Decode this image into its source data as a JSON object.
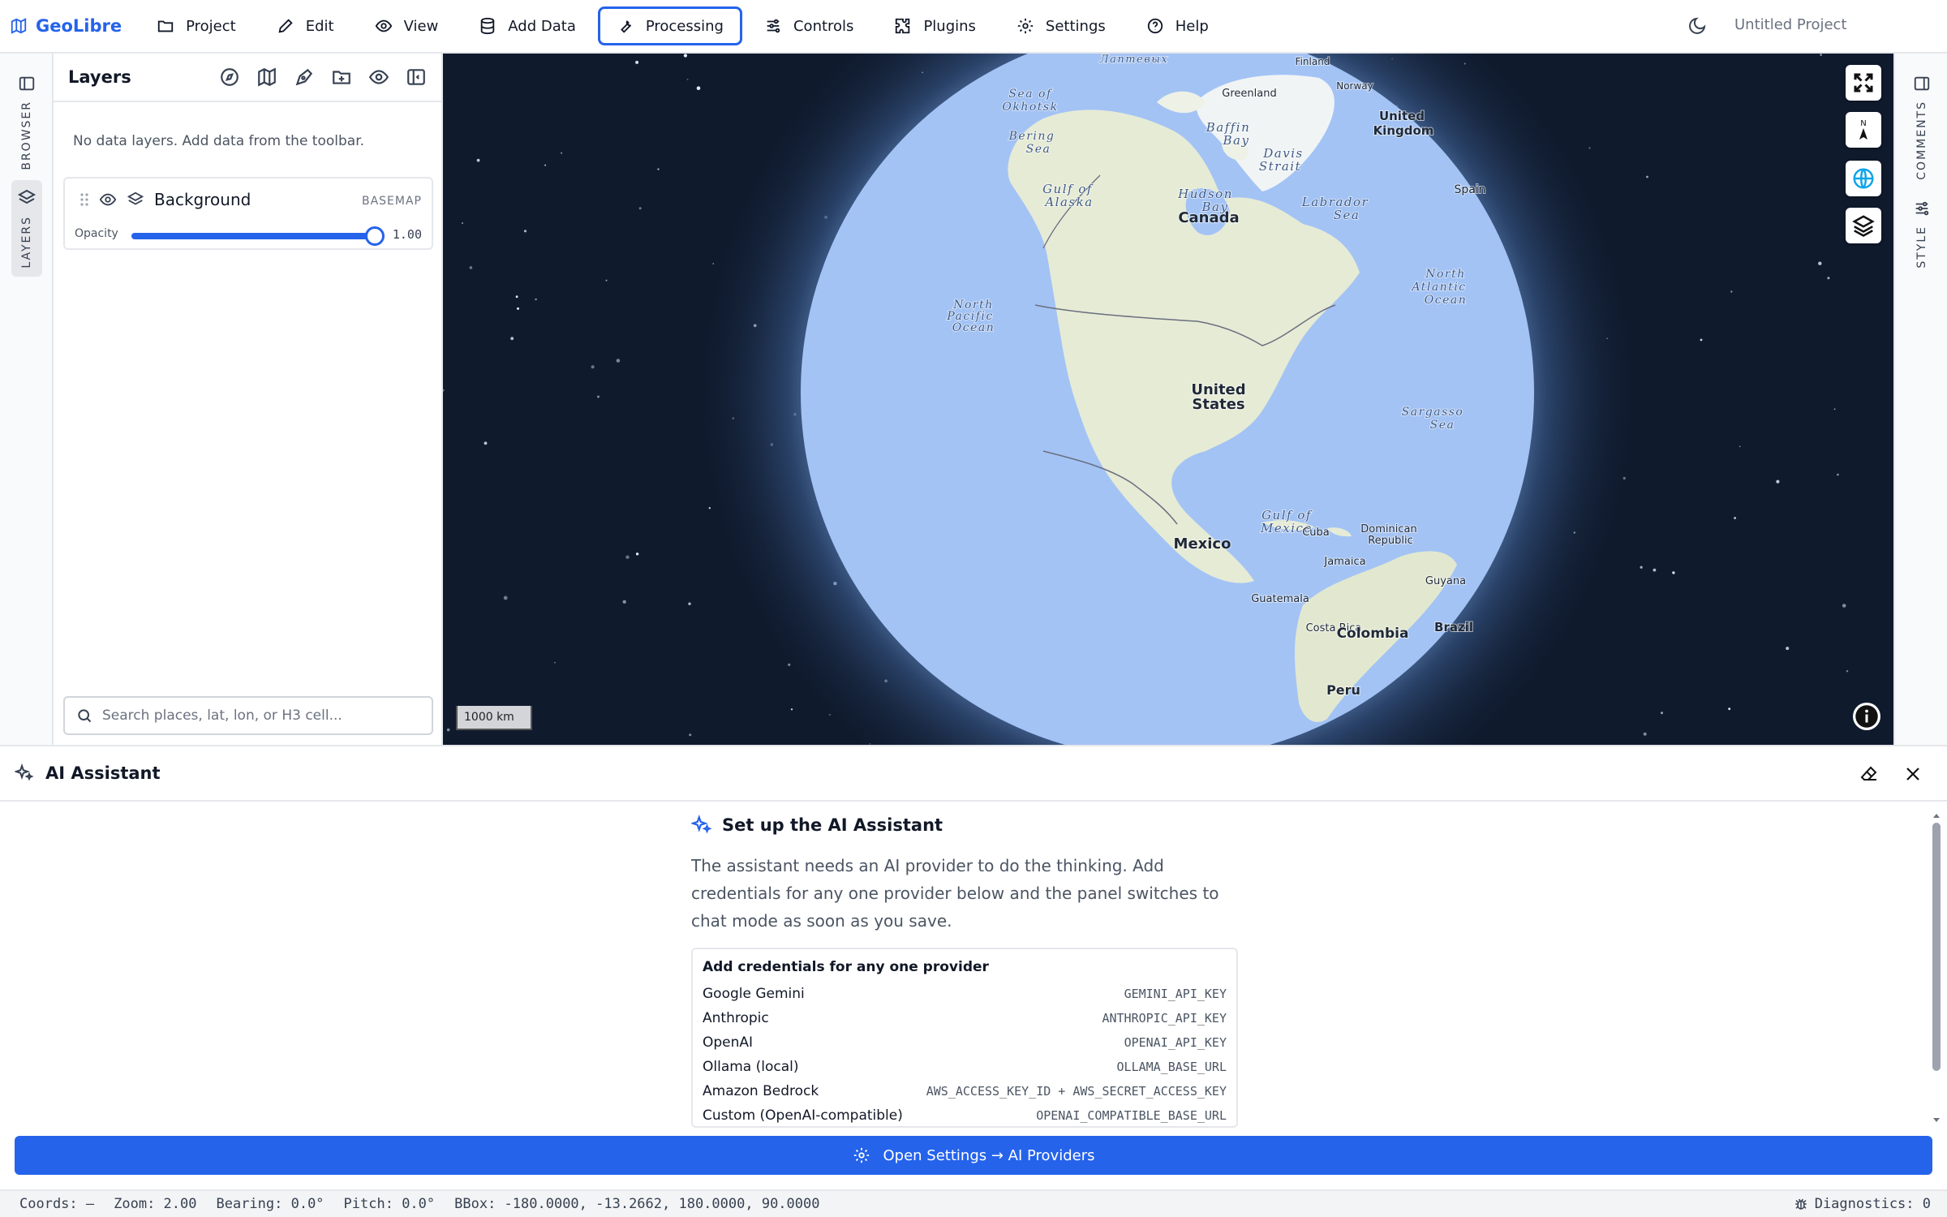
{
  "app": {
    "brand": "GeoLibre",
    "project_name": "Untitled Project"
  },
  "menu": [
    {
      "label": "Project",
      "icon": "folder-icon"
    },
    {
      "label": "Edit",
      "icon": "pencil-icon"
    },
    {
      "label": "View",
      "icon": "eye-icon"
    },
    {
      "label": "Add Data",
      "icon": "database-icon"
    },
    {
      "label": "Processing",
      "icon": "wrench-icon",
      "active": true
    },
    {
      "label": "Controls",
      "icon": "sliders-icon"
    },
    {
      "label": "Plugins",
      "icon": "puzzle-icon"
    },
    {
      "label": "Settings",
      "icon": "gear-icon"
    },
    {
      "label": "Help",
      "icon": "help-circle-icon"
    }
  ],
  "left_rail": {
    "browser": "BROWSER",
    "layers": "LAYERS"
  },
  "right_rail": {
    "comments": "COMMENTS",
    "style": "STYLE"
  },
  "layers_panel": {
    "title": "Layers",
    "empty_message": "No data layers. Add data from the toolbar.",
    "background_layer": {
      "name": "Background",
      "badge": "BASEMAP",
      "opacity_label": "Opacity",
      "opacity_value": "1.00",
      "opacity": 1.0
    },
    "search_placeholder": "Search places, lat, lon, or H3 cell..."
  },
  "map": {
    "scale": "1000 km",
    "labels": {
      "canada": "Canada",
      "us_line1": "United",
      "us_line2": "States",
      "mexico": "Mexico",
      "greenland": "Greenland",
      "finland": "Finland",
      "norway": "Norway",
      "uk_line1": "United",
      "uk_line2": "Kingdom",
      "spain": "Spain",
      "cuba": "Cuba",
      "dom_line1": "Dominican",
      "dom_line2": "Republic",
      "jamaica": "Jamaica",
      "guatemala": "Guatemala",
      "costa_rica": "Costa Rica",
      "colombia": "Colombia",
      "guyana": "Guyana",
      "brazil": "Brazil",
      "peru": "Peru",
      "sea_okhotsk_1": "Sea of",
      "sea_okhotsk_2": "Okhotsk",
      "bering_1": "Bering",
      "bering_2": "Sea",
      "gulf_alaska_1": "Gulf of",
      "gulf_alaska_2": "Alaska",
      "baffin_1": "Baffin",
      "baffin_2": "Bay",
      "davis_1": "Davis",
      "davis_2": "Strait",
      "hudson_1": "Hudson",
      "hudson_2": "Bay",
      "labrador_1": "Labrador",
      "labrador_2": "Sea",
      "npo_1": "North",
      "npo_2": "Pacific",
      "npo_3": "Ocean",
      "nao_1": "North",
      "nao_2": "Atlantic",
      "nao_3": "Ocean",
      "sargasso_1": "Sargasso",
      "sargasso_2": "Sea",
      "gom_1": "Gulf of",
      "gom_2": "Mexico",
      "laptev": "Лаптевых"
    }
  },
  "ai_panel": {
    "title": "AI Assistant",
    "setup_title": "Set up the AI Assistant",
    "setup_desc": "The assistant needs an AI provider to do the thinking. Add credentials for any one provider below and the panel switches to chat mode as soon as you save.",
    "providers_title": "Add credentials for any one provider",
    "providers": [
      {
        "name": "Google Gemini",
        "key": "GEMINI_API_KEY"
      },
      {
        "name": "Anthropic",
        "key": "ANTHROPIC_API_KEY"
      },
      {
        "name": "OpenAI",
        "key": "OPENAI_API_KEY"
      },
      {
        "name": "Ollama (local)",
        "key": "OLLAMA_BASE_URL"
      },
      {
        "name": "Amazon Bedrock",
        "key": "AWS_ACCESS_KEY_ID + AWS_SECRET_ACCESS_KEY"
      },
      {
        "name": "Custom (OpenAI-compatible)",
        "key": "OPENAI_COMPATIBLE_BASE_URL"
      }
    ],
    "open_settings_label": "Open Settings → AI Providers"
  },
  "status": {
    "coords": "Coords: —",
    "zoom": "Zoom: 2.00",
    "bearing": "Bearing: 0.0°",
    "pitch": "Pitch: 0.0°",
    "bbox": "BBox: -180.0000, -13.2662, 180.0000, 90.0000",
    "diagnostics": "Diagnostics: 0"
  },
  "colors": {
    "accent": "#2563eb",
    "space": "#101b2e",
    "ocean": "#a3c3f5",
    "land": "#e8ecd8"
  }
}
